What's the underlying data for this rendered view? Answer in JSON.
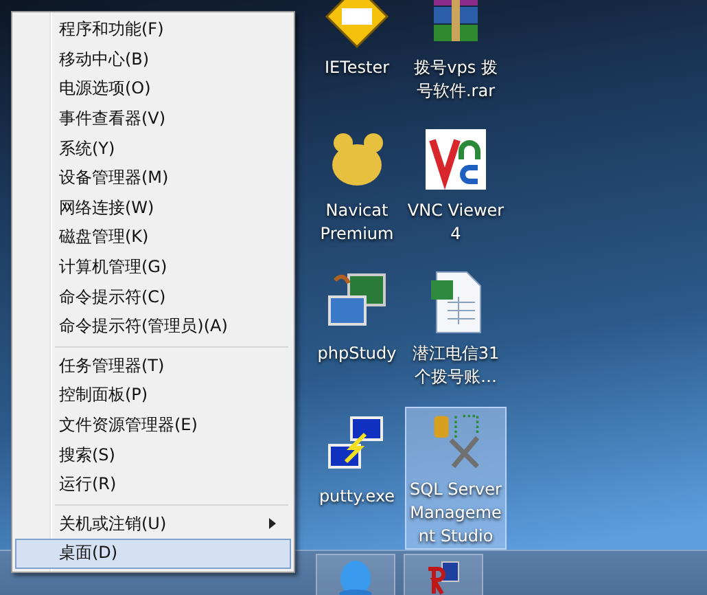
{
  "context_menu": {
    "groups": [
      {
        "items": [
          {
            "label": "程序和功能(F)",
            "selected": false,
            "submenu": false
          },
          {
            "label": "移动中心(B)",
            "selected": false,
            "submenu": false
          },
          {
            "label": "电源选项(O)",
            "selected": false,
            "submenu": false
          },
          {
            "label": "事件查看器(V)",
            "selected": false,
            "submenu": false
          },
          {
            "label": "系统(Y)",
            "selected": false,
            "submenu": false
          },
          {
            "label": "设备管理器(M)",
            "selected": false,
            "submenu": false
          },
          {
            "label": "网络连接(W)",
            "selected": false,
            "submenu": false
          },
          {
            "label": "磁盘管理(K)",
            "selected": false,
            "submenu": false
          },
          {
            "label": "计算机管理(G)",
            "selected": false,
            "submenu": false
          },
          {
            "label": "命令提示符(C)",
            "selected": false,
            "submenu": false
          },
          {
            "label": "命令提示符(管理员)(A)",
            "selected": false,
            "submenu": false
          }
        ]
      },
      {
        "items": [
          {
            "label": "任务管理器(T)",
            "selected": false,
            "submenu": false
          },
          {
            "label": "控制面板(P)",
            "selected": false,
            "submenu": false
          },
          {
            "label": "文件资源管理器(E)",
            "selected": false,
            "submenu": false
          },
          {
            "label": "搜索(S)",
            "selected": false,
            "submenu": false
          },
          {
            "label": "运行(R)",
            "selected": false,
            "submenu": false
          }
        ]
      },
      {
        "items": [
          {
            "label": "关机或注销(U)",
            "selected": false,
            "submenu": true
          },
          {
            "label": "桌面(D)",
            "selected": true,
            "submenu": false
          }
        ]
      }
    ]
  },
  "desktop_icons": [
    {
      "kind": "ietester",
      "lines": [
        "IETester"
      ],
      "selected": false
    },
    {
      "kind": "archive",
      "lines": [
        "拨号vps 拨",
        "号软件.rar"
      ],
      "selected": false
    },
    {
      "kind": "navicat",
      "lines": [
        "Navicat",
        "Premium"
      ],
      "selected": false
    },
    {
      "kind": "vnc",
      "lines": [
        "VNC Viewer",
        "4"
      ],
      "selected": false
    },
    {
      "kind": "phpstudy",
      "lines": [
        "phpStudy"
      ],
      "selected": false
    },
    {
      "kind": "spreadsheet",
      "lines": [
        "潜江电信31",
        "个拨号账…"
      ],
      "selected": false
    },
    {
      "kind": "putty",
      "lines": [
        "putty.exe"
      ],
      "selected": false
    },
    {
      "kind": "sqlserver",
      "lines": [
        "SQL Server",
        "Manageme",
        "nt Studio"
      ],
      "selected": true
    }
  ],
  "taskbar": {
    "buttons": [
      {
        "kind": "qq"
      },
      {
        "kind": "remote"
      }
    ]
  }
}
